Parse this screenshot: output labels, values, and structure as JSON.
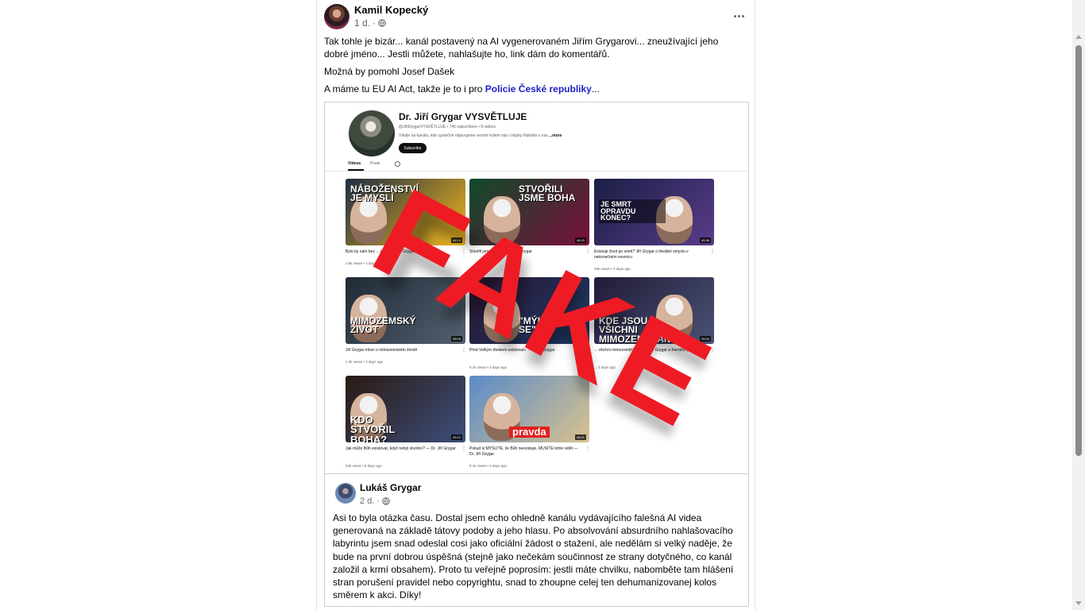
{
  "post": {
    "author": "Kamil Kopecký",
    "time": "1 d.",
    "separator": "·",
    "text_1": "Tak tohle je bizár... kanál postavený na AI vygenerovaném Jiřím Grygarovi... zneužívající jeho dobré jméno... Jestli můžete, nahlašujte ho, link dám do komentářů.",
    "text_2": "Možná by pomohl Josef Dašek",
    "text_3_prefix": "A máme tu EU AI Act, takže je to i pro ",
    "text_3_link": "Policie České republiky",
    "text_3_suffix": "..."
  },
  "shared": {
    "channel": {
      "name": "Dr. Jiří Grygar VYSVĚTLUJE",
      "handle": "@JiříGrygarVYSVĚTLUJE • 745 subscribers • 8 videos",
      "description": "Vítejte na kanálu, kde společně objevujeme vesmír kolem nás i otázky hluboké v nás",
      "more": "...more",
      "subscribe": "Subscribe",
      "tabs": [
        "Videos",
        "Posts"
      ]
    },
    "videos": [
      {
        "thumb_text": "NÁBOŽENSTVÍ JE MYSLÍ",
        "duration": "46:19",
        "title": "Bylo by nám bez ... lépe? — Jiří Grygar",
        "meta": "3.5k views • 3 days ago",
        "colors": [
          "#1d2d44",
          "#f0b61c"
        ]
      },
      {
        "thumb_text": "STVOŘILI JSME BOHA",
        "duration": "46:20",
        "title": "Stvořili jsme Boha — Dr. Jiří Grygar",
        "meta": "",
        "colors": [
          "#0f4a2a",
          "#7a0f3c"
        ]
      },
      {
        "thumb_text": "JE SMRT OPRAVDU KONEC?",
        "duration": "45:38",
        "title": "Existuje život po smrti? Jiří Grygar o hledání smyslu v nekonečném vesmíru",
        "meta": "29k views • 3 days ago",
        "colors": [
          "#1a1f46",
          "#5a3c8a"
        ]
      },
      {
        "thumb_text": "MIMOZEMSKÝ ŽIVOT",
        "duration": "38:00",
        "title": "Jiří Grygar mluví o mimozemském životě",
        "meta": "1.2k views • 3 days ago",
        "colors": [
          "#1f2a37",
          "#55606e"
        ]
      },
      {
        "thumb_text": "\"MÝLIL JSEM SE\"",
        "duration": "42:10",
        "title": "Před Velkým třeskem existovalo ... — Jiří Grygar",
        "meta": "8.1k views • 3 days ago",
        "colors": [
          "#2b1430",
          "#1c3b66"
        ]
      },
      {
        "thumb_text": "KDE JSOU VŠICHNI MIMOZEMŠŤANÉ?",
        "duration": "39:20",
        "title": "... všichni mimozemšťané? Dr. Jiří Grygar a Fermiho paradox",
        "meta": "... 3 days ago",
        "colors": [
          "#221b3a",
          "#4a5272"
        ]
      },
      {
        "thumb_text": "KDO STVOŘIL BOHA?",
        "duration": "49:12",
        "title": "Jak může Bůh existovat, když nebyl stvořen? — Dr. Jiří Grygar",
        "meta": "34k views • 5 days ago",
        "colors": [
          "#2a1a12",
          "#3d4f7c"
        ]
      },
      {
        "thumb_text": "pravda",
        "duration": "46:01",
        "title": "Pokud si MYSLÍTE, že Bůh neexistuje, MUSÍTE tohle vidět — Dr. Jiří Grygar",
        "meta": "9.1k views • 6 days ago",
        "colors": [
          "#5a8bc8",
          "#d8c28f"
        ]
      }
    ],
    "stamp": "FAKE",
    "stamp_color": "#ee1b24"
  },
  "comment": {
    "author": "Lukáš Grygar",
    "time": "2 d.",
    "separator": "·",
    "text": "Asi to byla otázka času. Dostal jsem echo ohledně kanálu vydávajícího falešná AI videa generovaná na základě tátovy podoby a jeho hlasu. Po absolvování absurdního nahlašovacího labyrintu jsem snad odeslal cosi jako oficiální žádost o stažení, ale nedělám si velký naděje, že bude na první dobrou úspěšná (stejně jako nečekám součinnost ze strany dotyčného, co kanál založil a krmí obsahem). Proto tu veřejně poprosím: jestli máte chvilku, nabomběte tam hlášení stran porušení pravidel nebo copyrightu, snad to zhoupne celej ten dehumanizovanej kolos směrem k akci. Díky!"
  },
  "icons": [
    "globe-icon",
    "more-options-icon",
    "search-icon",
    "kebab-menu-icon"
  ]
}
